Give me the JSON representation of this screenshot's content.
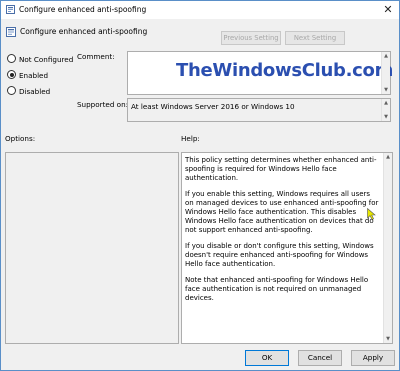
{
  "window": {
    "title": "Configure enhanced anti-spoofing",
    "close_glyph": "✕"
  },
  "header": {
    "policy_name": "Configure enhanced anti-spoofing",
    "previous_label": "Previous Setting",
    "next_label": "Next Setting"
  },
  "state": {
    "options": [
      {
        "label": "Not Configured",
        "selected": false
      },
      {
        "label": "Enabled",
        "selected": true
      },
      {
        "label": "Disabled",
        "selected": false
      }
    ]
  },
  "comment": {
    "label": "Comment:",
    "watermark": "TheWindowsClub.com"
  },
  "supported": {
    "label": "Supported on:",
    "value": "At least Windows Server 2016 or Windows 10"
  },
  "options_label": "Options:",
  "help": {
    "label": "Help:",
    "paragraphs": [
      "This policy setting determines whether enhanced anti-spoofing is required for Windows Hello face authentication.",
      "If you enable this setting, Windows requires all users on managed devices to use enhanced anti-spoofing for Windows Hello face authentication. This disables Windows Hello face authentication on devices that do not support enhanced anti-spoofing.",
      "If you disable or don't configure this setting, Windows doesn't require enhanced anti-spoofing for Windows Hello face authentication.",
      "Note that enhanced anti-spoofing for Windows Hello face authentication is not required on unmanaged devices."
    ]
  },
  "footer": {
    "ok_label": "OK",
    "cancel_label": "Cancel",
    "apply_label": "Apply"
  },
  "colors": {
    "accent": "#0078d7",
    "watermark": "#2b4fb0",
    "cursor": "#e8e800"
  }
}
